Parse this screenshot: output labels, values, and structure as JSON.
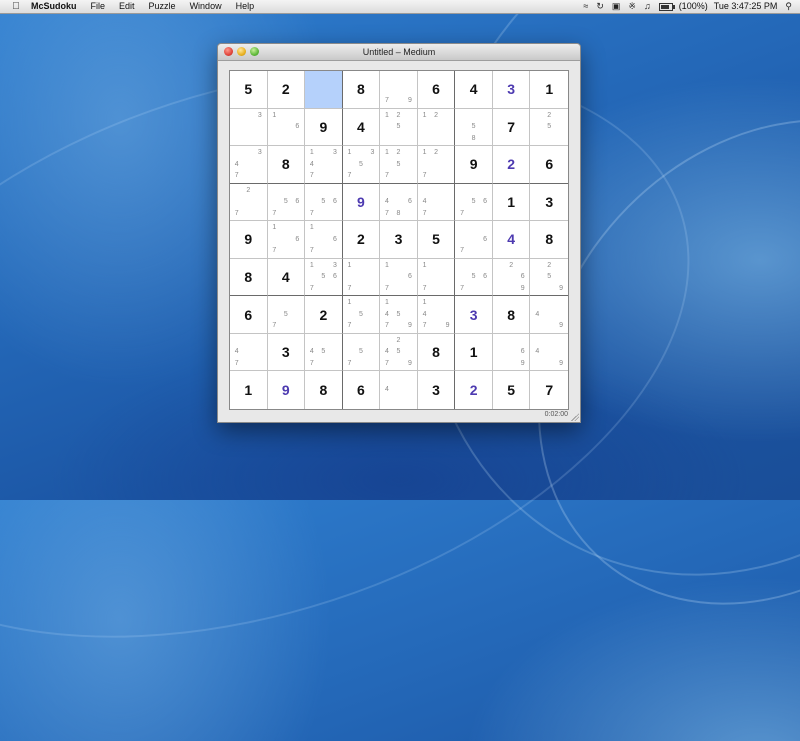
{
  "menubar": {
    "app_name": "McSudoku",
    "items": [
      "File",
      "Edit",
      "Puzzle",
      "Window",
      "Help"
    ],
    "battery_text": "(100%)",
    "clock": "Tue 3:47:25 PM"
  },
  "window": {
    "title": "Untitled – Medium",
    "timer": "0:02:00"
  },
  "board": {
    "selected_cell": [
      0,
      2
    ],
    "cells": [
      [
        {
          "v": "5"
        },
        {
          "v": "2"
        },
        {
          "v": ""
        },
        {
          "v": "8"
        },
        {
          "notes": [
            "7",
            "9"
          ]
        },
        {
          "v": "6"
        },
        {
          "v": "4"
        },
        {
          "v": "3",
          "user": true
        },
        {
          "v": "1"
        }
      ],
      [
        {
          "notes": [
            "3"
          ]
        },
        {
          "notes": [
            "1",
            "6"
          ]
        },
        {
          "v": "9"
        },
        {
          "v": "4"
        },
        {
          "notes": [
            "1",
            "2",
            "5"
          ]
        },
        {
          "notes": [
            "1",
            "2"
          ]
        },
        {
          "notes": [
            "5",
            "8"
          ]
        },
        {
          "v": "7"
        },
        {
          "notes": [
            "2",
            "5"
          ]
        }
      ],
      [
        {
          "notes": [
            "3",
            "4",
            "7"
          ]
        },
        {
          "v": "8"
        },
        {
          "notes": [
            "1",
            "3",
            "4",
            "7"
          ]
        },
        {
          "notes": [
            "1",
            "3",
            "5",
            "7"
          ]
        },
        {
          "notes": [
            "1",
            "2",
            "5",
            "7"
          ]
        },
        {
          "notes": [
            "1",
            "2",
            "7"
          ]
        },
        {
          "v": "9"
        },
        {
          "v": "2",
          "user": true
        },
        {
          "v": "6"
        }
      ],
      [
        {
          "notes": [
            "2",
            "7"
          ]
        },
        {
          "notes": [
            "5",
            "6",
            "7"
          ]
        },
        {
          "notes": [
            "5",
            "6",
            "7"
          ]
        },
        {
          "v": "9",
          "user": true
        },
        {
          "notes": [
            "4",
            "6",
            "7",
            "8"
          ]
        },
        {
          "notes": [
            "4",
            "7"
          ]
        },
        {
          "notes": [
            "5",
            "6",
            "7"
          ]
        },
        {
          "v": "1"
        },
        {
          "v": "3"
        }
      ],
      [
        {
          "v": "9"
        },
        {
          "notes": [
            "1",
            "6",
            "7"
          ]
        },
        {
          "notes": [
            "1",
            "6",
            "7"
          ]
        },
        {
          "v": "2"
        },
        {
          "v": "3"
        },
        {
          "v": "5"
        },
        {
          "notes": [
            "6",
            "7"
          ]
        },
        {
          "v": "4",
          "user": true
        },
        {
          "v": "8"
        }
      ],
      [
        {
          "v": "8"
        },
        {
          "v": "4"
        },
        {
          "notes": [
            "1",
            "3",
            "5",
            "6",
            "7"
          ]
        },
        {
          "notes": [
            "1",
            "7"
          ]
        },
        {
          "notes": [
            "1",
            "6",
            "7"
          ]
        },
        {
          "notes": [
            "1",
            "7"
          ]
        },
        {
          "notes": [
            "5",
            "6",
            "7"
          ]
        },
        {
          "notes": [
            "2",
            "6",
            "9"
          ]
        },
        {
          "notes": [
            "2",
            "5",
            "9"
          ]
        }
      ],
      [
        {
          "v": "6"
        },
        {
          "notes": [
            "5",
            "7"
          ]
        },
        {
          "v": "2"
        },
        {
          "notes": [
            "1",
            "5",
            "7"
          ]
        },
        {
          "notes": [
            "1",
            "4",
            "5",
            "7",
            "9"
          ]
        },
        {
          "notes": [
            "1",
            "4",
            "7",
            "9"
          ]
        },
        {
          "v": "3",
          "user": true
        },
        {
          "v": "8"
        },
        {
          "notes": [
            "4",
            "9"
          ]
        }
      ],
      [
        {
          "notes": [
            "4",
            "7"
          ]
        },
        {
          "v": "3"
        },
        {
          "notes": [
            "4",
            "5",
            "7"
          ]
        },
        {
          "notes": [
            "5",
            "7"
          ]
        },
        {
          "notes": [
            "2",
            "4",
            "5",
            "7",
            "9"
          ]
        },
        {
          "v": "8"
        },
        {
          "v": "1"
        },
        {
          "notes": [
            "6",
            "9"
          ]
        },
        {
          "notes": [
            "4",
            "9"
          ]
        }
      ],
      [
        {
          "v": "1"
        },
        {
          "v": "9",
          "user": true
        },
        {
          "v": "8"
        },
        {
          "v": "6"
        },
        {
          "notes": [
            "4"
          ]
        },
        {
          "v": "3"
        },
        {
          "v": "2",
          "user": true
        },
        {
          "v": "5"
        },
        {
          "v": "7"
        }
      ]
    ]
  }
}
